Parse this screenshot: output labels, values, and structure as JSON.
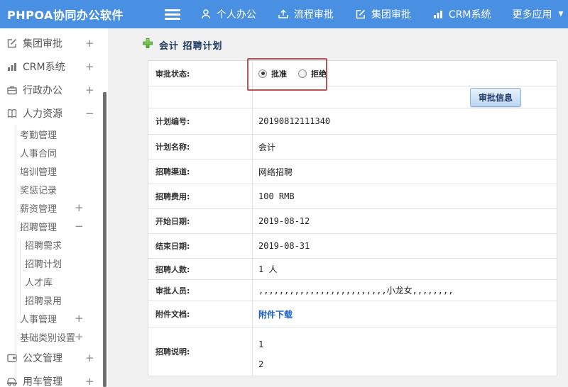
{
  "topbar": {
    "brand": "PHPOA协同办公软件",
    "nav": [
      {
        "label": "个人办公",
        "icon": "person-icon"
      },
      {
        "label": "流程审批",
        "icon": "flow-icon"
      },
      {
        "label": "集团审批",
        "icon": "edit-icon"
      },
      {
        "label": "CRM系统",
        "icon": "chart-icon"
      },
      {
        "label": "更多应用",
        "icon": "caret-down-icon"
      }
    ]
  },
  "sidebar": {
    "items": [
      {
        "label": "集团审批",
        "toggle": "+"
      },
      {
        "label": "CRM系统",
        "toggle": "+"
      },
      {
        "label": "行政办公",
        "toggle": "+"
      },
      {
        "label": "人力资源",
        "toggle": "−"
      },
      {
        "label": "考勤管理",
        "toggle": ""
      },
      {
        "label": "人事合同",
        "toggle": ""
      },
      {
        "label": "培训管理",
        "toggle": ""
      },
      {
        "label": "奖惩记录",
        "toggle": ""
      },
      {
        "label": "薪资管理",
        "toggle": "+"
      },
      {
        "label": "招聘管理",
        "toggle": "−"
      },
      {
        "label": "招聘需求",
        "toggle": ""
      },
      {
        "label": "招聘计划",
        "toggle": ""
      },
      {
        "label": "人才库",
        "toggle": ""
      },
      {
        "label": "招聘录用",
        "toggle": ""
      },
      {
        "label": "人事管理",
        "toggle": "+"
      },
      {
        "label": "基础类别设置",
        "toggle": "+"
      },
      {
        "label": "公文管理",
        "toggle": "+"
      },
      {
        "label": "用车管理",
        "toggle": "+"
      }
    ]
  },
  "main": {
    "title": "会计 招聘计划",
    "status": {
      "label": "审批状态:",
      "options": [
        {
          "label": "批准",
          "selected": true
        },
        {
          "label": "拒绝",
          "selected": false
        }
      ]
    },
    "approve_button_label": "审批信息",
    "fields": [
      {
        "label": "计划编号:",
        "value": "20190812111340"
      },
      {
        "label": "计划名称:",
        "value": "会计"
      },
      {
        "label": "招聘渠道:",
        "value": "网络招聘"
      },
      {
        "label": "招聘费用:",
        "value": "100 RMB"
      },
      {
        "label": "开始日期:",
        "value": "2019-08-12"
      },
      {
        "label": "结束日期:",
        "value": "2019-08-31"
      },
      {
        "label": "招聘人数:",
        "value": "1 人"
      },
      {
        "label": "审批人员:",
        "value": ",,,,,,,,,,,,,,,,,,,,,,,,,小龙女,,,,,,,,"
      },
      {
        "label": "附件文档:",
        "value": "附件下载"
      },
      {
        "label": "招聘说明:",
        "value": "1\n2"
      }
    ],
    "colors": {
      "topbar_blue": "#4a90e2",
      "annotation_red": "#b85456",
      "title_navy": "#17365d",
      "link_blue": "#1a62c5"
    }
  }
}
